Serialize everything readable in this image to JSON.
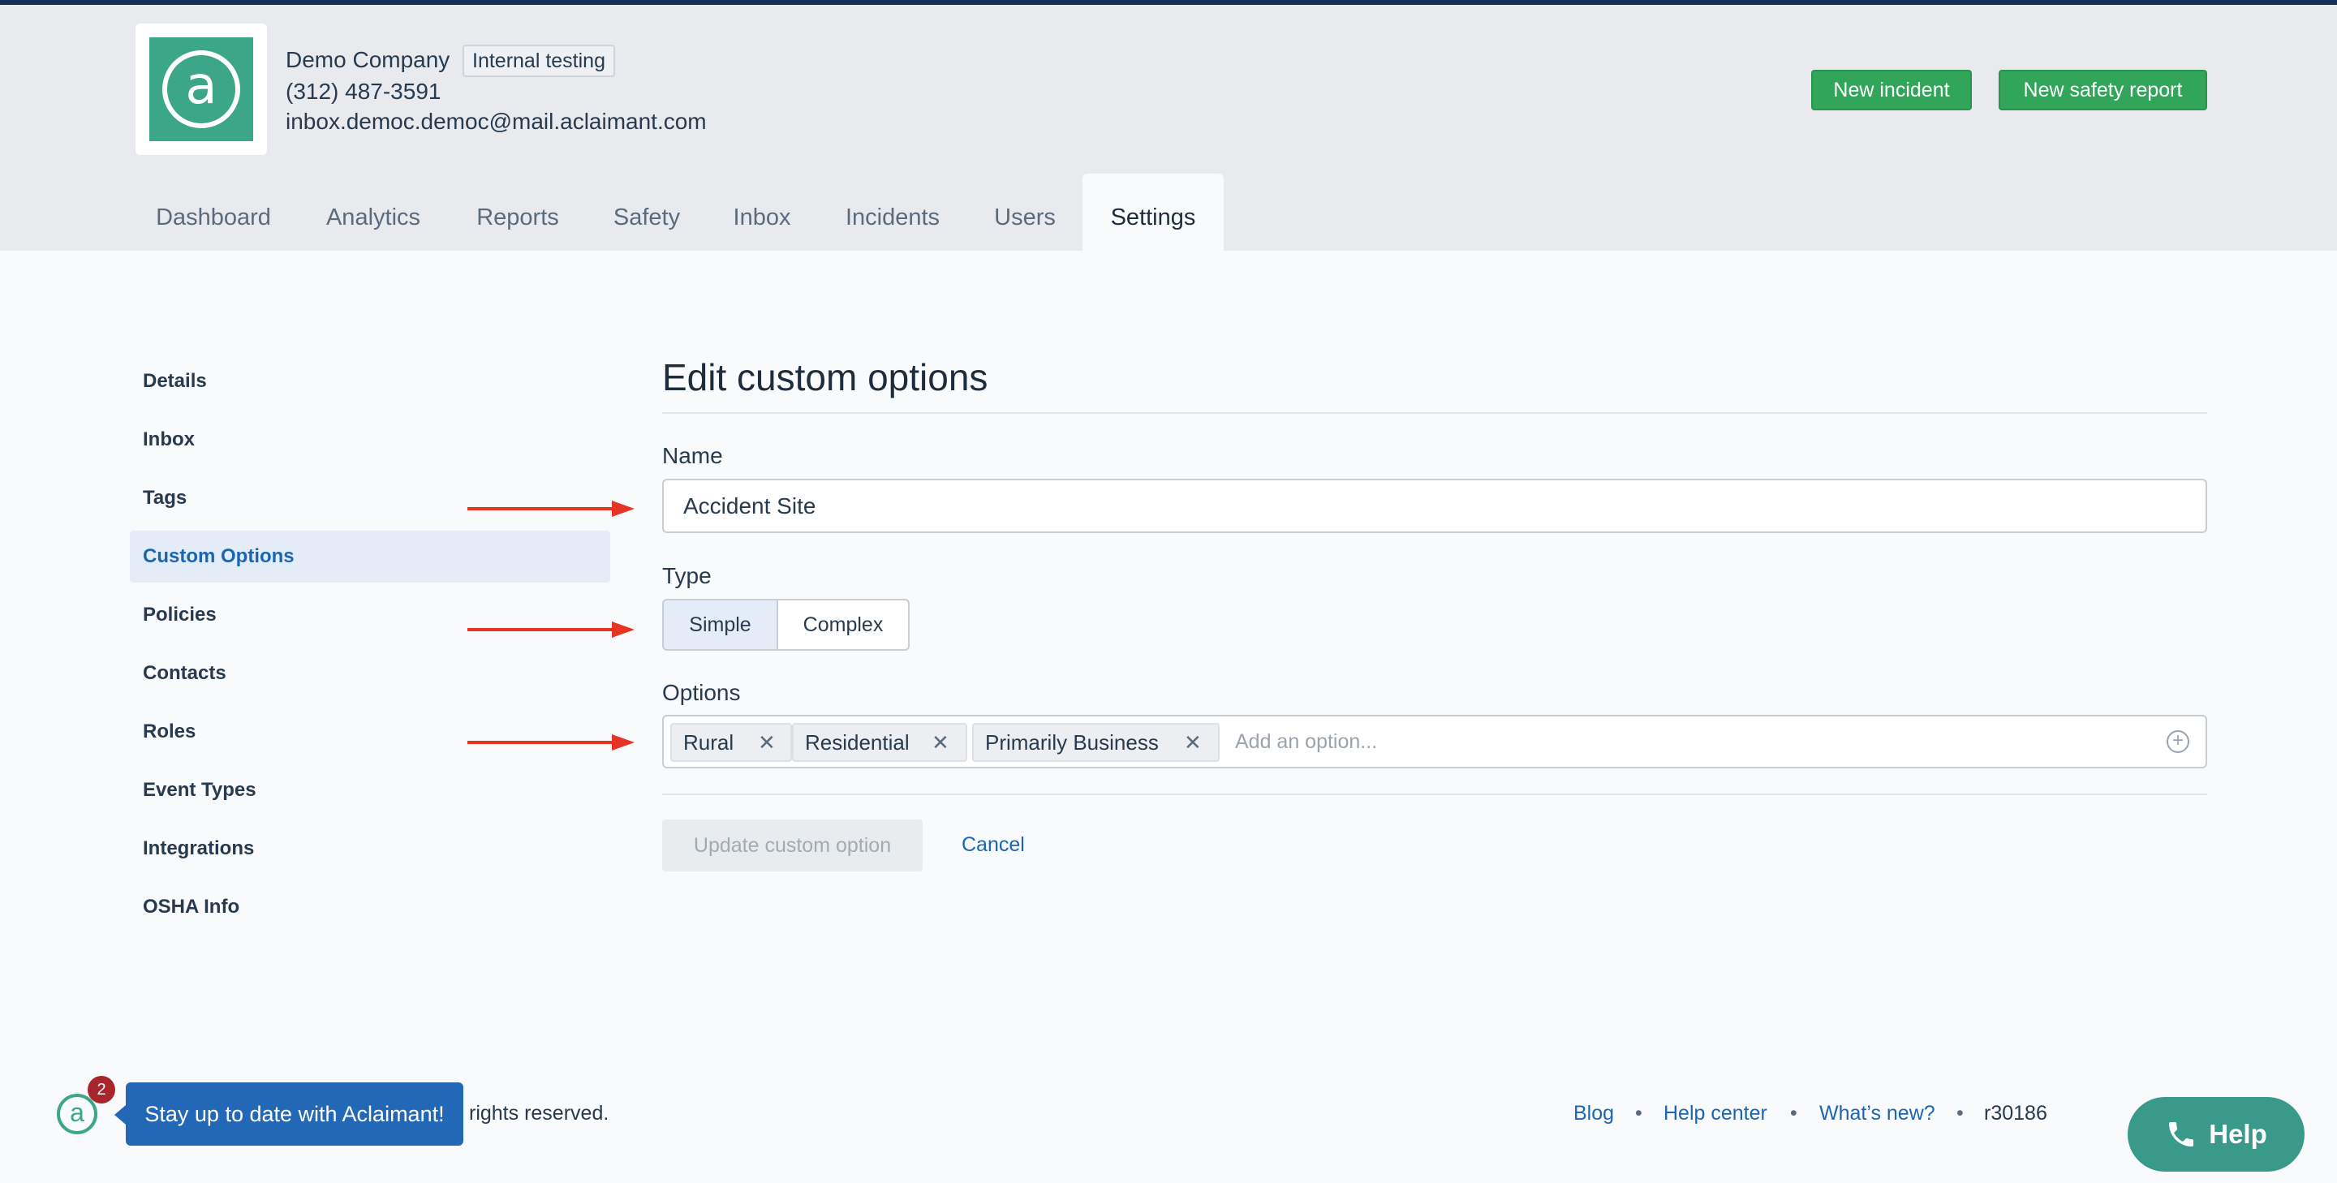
{
  "company": {
    "name": "Demo Company",
    "badge": "Internal testing",
    "phone": "(312) 487-3591",
    "email": "inbox.democ.democ@mail.aclaimant.com",
    "logo_glyph": "a"
  },
  "actions": {
    "new_incident": "New incident",
    "new_safety_report": "New safety report"
  },
  "nav": {
    "tabs": [
      "Dashboard",
      "Analytics",
      "Reports",
      "Safety",
      "Inbox",
      "Incidents",
      "Users",
      "Settings"
    ],
    "active": "Settings"
  },
  "sidebar": {
    "items": [
      "Details",
      "Inbox",
      "Tags",
      "Custom Options",
      "Policies",
      "Contacts",
      "Roles",
      "Event Types",
      "Integrations",
      "OSHA Info"
    ],
    "active": "Custom Options"
  },
  "form": {
    "title": "Edit custom options",
    "name_label": "Name",
    "name_value": "Accident Site",
    "type_label": "Type",
    "type_options": [
      "Simple",
      "Complex"
    ],
    "type_selected": "Simple",
    "options_label": "Options",
    "options": [
      "Rural",
      "Residential",
      "Primarily Business"
    ],
    "options_placeholder": "Add an option...",
    "update_label": "Update custom option",
    "cancel_label": "Cancel"
  },
  "chat": {
    "badge_count": "2",
    "promo": "Stay up to date with Aclaimant!"
  },
  "footer": {
    "copyright_tail": "rights reserved.",
    "links": [
      "Blog",
      "Help center",
      "What’s new?"
    ],
    "separator": "•",
    "revision": "r30186"
  },
  "help": {
    "label": "Help"
  },
  "colors": {
    "brand_green": "#3ba688",
    "button_green": "#31a65b",
    "link_blue": "#1b65b3",
    "arrow_red": "#e63322",
    "help_teal": "#3a9a8a"
  }
}
